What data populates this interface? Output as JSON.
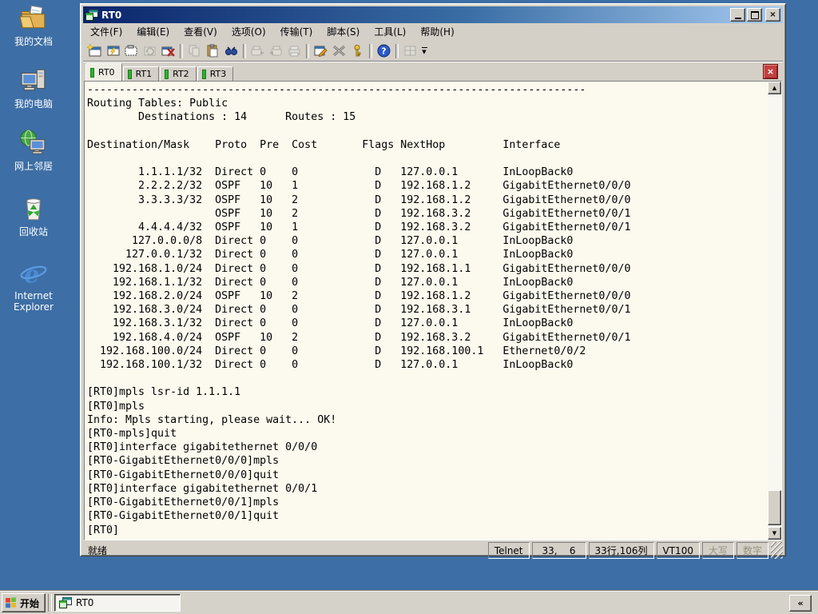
{
  "desktop": {
    "background_color": "#3D6EA5",
    "icons": [
      {
        "name": "my-documents",
        "label": "我的文档"
      },
      {
        "name": "my-computer",
        "label": "我的电脑"
      },
      {
        "name": "network-places",
        "label": "网上邻居"
      },
      {
        "name": "recycle-bin",
        "label": "回收站"
      },
      {
        "name": "internet-explorer",
        "label": "Internet Explorer"
      }
    ]
  },
  "window": {
    "title": "RT0",
    "controls": {
      "close_glyph": "×"
    },
    "menu": {
      "items": [
        "文件(F)",
        "编辑(E)",
        "查看(V)",
        "选项(O)",
        "传输(T)",
        "脚本(S)",
        "工具(L)",
        "帮助(H)"
      ]
    },
    "toolbar": {
      "icons": [
        "new-session-icon",
        "connect-icon",
        "quick-connect-icon",
        "reconnect-icon",
        "disconnect-icon",
        "copy-icon",
        "paste-icon",
        "find-icon",
        "send-file-icon",
        "receive-file-icon",
        "print-icon",
        "session-options-icon",
        "global-options-icon",
        "key-agent-icon",
        "help-icon",
        "windows-icon",
        "toolbar-overflow-icon"
      ]
    },
    "tabs": {
      "items": [
        {
          "label": "RT0",
          "active": true
        },
        {
          "label": "RT1",
          "active": false
        },
        {
          "label": "RT2",
          "active": false
        },
        {
          "label": "RT3",
          "active": false
        }
      ],
      "close_glyph": "×"
    },
    "terminal": {
      "lines": [
        "------------------------------------------------------------------------------",
        "Routing Tables: Public",
        "        Destinations : 14      Routes : 15",
        "",
        "Destination/Mask    Proto  Pre  Cost       Flags NextHop         Interface",
        "",
        "        1.1.1.1/32  Direct 0    0            D   127.0.0.1       InLoopBack0",
        "        2.2.2.2/32  OSPF   10   1            D   192.168.1.2     GigabitEthernet0/0/0",
        "        3.3.3.3/32  OSPF   10   2            D   192.168.1.2     GigabitEthernet0/0/0",
        "                    OSPF   10   2            D   192.168.3.2     GigabitEthernet0/0/1",
        "        4.4.4.4/32  OSPF   10   1            D   192.168.3.2     GigabitEthernet0/0/1",
        "       127.0.0.0/8  Direct 0    0            D   127.0.0.1       InLoopBack0",
        "      127.0.0.1/32  Direct 0    0            D   127.0.0.1       InLoopBack0",
        "    192.168.1.0/24  Direct 0    0            D   192.168.1.1     GigabitEthernet0/0/0",
        "    192.168.1.1/32  Direct 0    0            D   127.0.0.1       InLoopBack0",
        "    192.168.2.0/24  OSPF   10   2            D   192.168.1.2     GigabitEthernet0/0/0",
        "    192.168.3.0/24  Direct 0    0            D   192.168.3.1     GigabitEthernet0/0/1",
        "    192.168.3.1/32  Direct 0    0            D   127.0.0.1       InLoopBack0",
        "    192.168.4.0/24  OSPF   10   2            D   192.168.3.2     GigabitEthernet0/0/1",
        "  192.168.100.0/24  Direct 0    0            D   192.168.100.1   Ethernet0/0/2",
        "  192.168.100.1/32  Direct 0    0            D   127.0.0.1       InLoopBack0",
        "",
        "[RT0]mpls lsr-id 1.1.1.1",
        "[RT0]mpls",
        "Info: Mpls starting, please wait... OK!",
        "[RT0-mpls]quit",
        "[RT0]interface gigabitethernet 0/0/0",
        "[RT0-GigabitEthernet0/0/0]mpls",
        "[RT0-GigabitEthernet0/0/0]quit",
        "[RT0]interface gigabitethernet 0/0/1",
        "[RT0-GigabitEthernet0/0/1]mpls",
        "[RT0-GigabitEthernet0/0/1]quit",
        "[RT0]"
      ]
    },
    "routing_table": {
      "title": "Routing Tables: Public",
      "destinations": 14,
      "routes": 15,
      "headers": [
        "Destination/Mask",
        "Proto",
        "Pre",
        "Cost",
        "Flags",
        "NextHop",
        "Interface"
      ],
      "rows": [
        [
          "1.1.1.1/32",
          "Direct",
          "0",
          "0",
          "D",
          "127.0.0.1",
          "InLoopBack0"
        ],
        [
          "2.2.2.2/32",
          "OSPF",
          "10",
          "1",
          "D",
          "192.168.1.2",
          "GigabitEthernet0/0/0"
        ],
        [
          "3.3.3.3/32",
          "OSPF",
          "10",
          "2",
          "D",
          "192.168.1.2",
          "GigabitEthernet0/0/0"
        ],
        [
          "",
          "OSPF",
          "10",
          "2",
          "D",
          "192.168.3.2",
          "GigabitEthernet0/0/1"
        ],
        [
          "4.4.4.4/32",
          "OSPF",
          "10",
          "1",
          "D",
          "192.168.3.2",
          "GigabitEthernet0/0/1"
        ],
        [
          "127.0.0.0/8",
          "Direct",
          "0",
          "0",
          "D",
          "127.0.0.1",
          "InLoopBack0"
        ],
        [
          "127.0.0.1/32",
          "Direct",
          "0",
          "0",
          "D",
          "127.0.0.1",
          "InLoopBack0"
        ],
        [
          "192.168.1.0/24",
          "Direct",
          "0",
          "0",
          "D",
          "192.168.1.1",
          "GigabitEthernet0/0/0"
        ],
        [
          "192.168.1.1/32",
          "Direct",
          "0",
          "0",
          "D",
          "127.0.0.1",
          "InLoopBack0"
        ],
        [
          "192.168.2.0/24",
          "OSPF",
          "10",
          "2",
          "D",
          "192.168.1.2",
          "GigabitEthernet0/0/0"
        ],
        [
          "192.168.3.0/24",
          "Direct",
          "0",
          "0",
          "D",
          "192.168.3.1",
          "GigabitEthernet0/0/1"
        ],
        [
          "192.168.3.1/32",
          "Direct",
          "0",
          "0",
          "D",
          "127.0.0.1",
          "InLoopBack0"
        ],
        [
          "192.168.4.0/24",
          "OSPF",
          "10",
          "2",
          "D",
          "192.168.3.2",
          "GigabitEthernet0/0/1"
        ],
        [
          "192.168.100.0/24",
          "Direct",
          "0",
          "0",
          "D",
          "192.168.100.1",
          "Ethernet0/0/2"
        ],
        [
          "192.168.100.1/32",
          "Direct",
          "0",
          "0",
          "D",
          "127.0.0.1",
          "InLoopBack0"
        ]
      ]
    },
    "status_bar": {
      "ready": "就绪",
      "protocol": "Telnet",
      "cursor_position": "33,    6",
      "grid_size": "33行,106列",
      "emulation": "VT100",
      "caps_lock": "大写",
      "num_lock": "数字"
    }
  },
  "taskbar": {
    "start_label": "开始",
    "tasks": [
      {
        "label": "RT0",
        "active": true
      }
    ],
    "overflow_label": "«"
  }
}
